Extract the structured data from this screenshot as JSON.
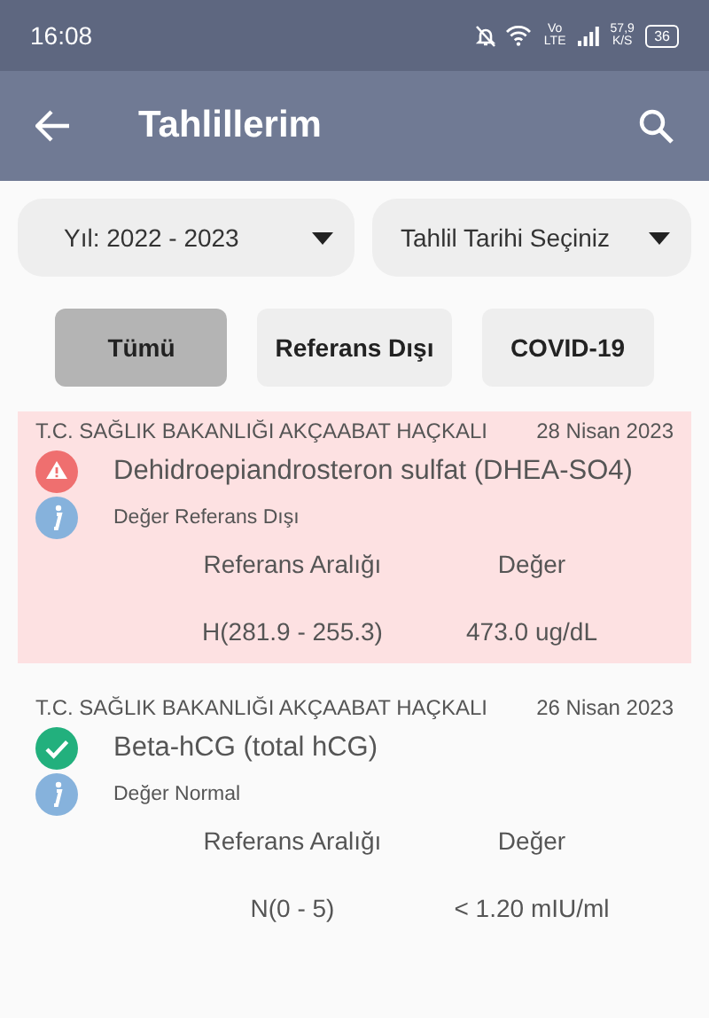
{
  "status_bar": {
    "time": "16:08",
    "network": "Vo LTE",
    "speed": "57,9 K/S",
    "battery": "36"
  },
  "app_bar": {
    "title": "Tahlillerim"
  },
  "filters": [
    {
      "label": "Yıl: 2022 - 2023"
    },
    {
      "label": "Tahlil Tarihi Seçiniz"
    }
  ],
  "tabs": [
    {
      "label": "Tümü",
      "selected": true
    },
    {
      "label": "Referans Dışı",
      "selected": false
    },
    {
      "label": "COVID-19",
      "selected": false
    }
  ],
  "results": [
    {
      "institution": "T.C. SAĞLIK BAKANLIĞI AKÇAABAT HAÇKALI",
      "date": "28 Nisan 2023",
      "test": "Dehidroepiandrosteron sulfat (DHEA-SO4)",
      "kind": "abnormal",
      "note": "Değer Referans Dışı",
      "range_label": "Referans Aralığı",
      "value_label": "Değer",
      "range": "H(281.9 - 255.3)",
      "value": "473.0 ug/dL"
    },
    {
      "institution": "T.C. SAĞLIK BAKANLIĞI AKÇAABAT HAÇKALI",
      "date": "26 Nisan 2023",
      "test": "Beta-hCG (total hCG)",
      "kind": "normal",
      "note": "Değer Normal",
      "range_label": "Referans Aralığı",
      "value_label": "Değer",
      "range": "N(0 - 5)",
      "value": "< 1.20 mIU/ml"
    }
  ]
}
